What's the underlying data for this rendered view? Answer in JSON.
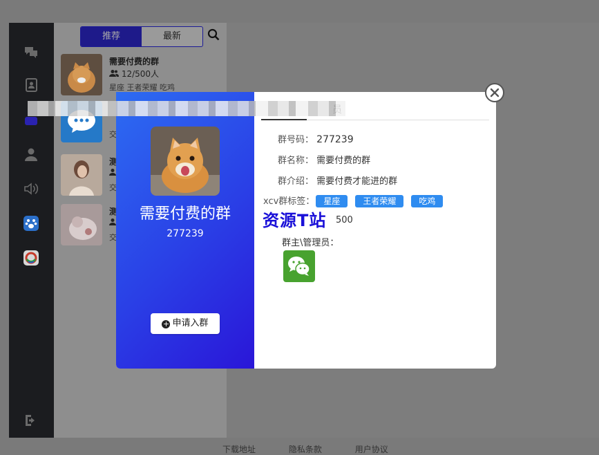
{
  "sidebar": {
    "icons": [
      "chat-icon",
      "contacts-icon",
      "group-icon",
      "user-icon",
      "speaker-icon",
      "paw-icon",
      "circle-app-icon",
      "logout-icon"
    ]
  },
  "list": {
    "tabs": [
      {
        "label": "推荐"
      },
      {
        "label": "最新"
      }
    ],
    "items": [
      {
        "title": "需要付费的群",
        "sub": "12/500人",
        "tags": "星座 王者荣耀 吃鸡"
      },
      {
        "title": "",
        "sub": "",
        "tags": "交"
      },
      {
        "title": "测",
        "sub": "",
        "tags": "交"
      },
      {
        "title": "测",
        "sub": "",
        "tags": "交"
      }
    ]
  },
  "bottom_links": [
    "下载地址",
    "隐私条款",
    "用户协议"
  ],
  "modal": {
    "name": "需要付费的群",
    "id": "277239",
    "join_label": "申请入群",
    "tab_label": "员",
    "fields": [
      {
        "label": "群号码：",
        "value": "277239"
      },
      {
        "label": "群名称：",
        "value": "需要付费的群"
      },
      {
        "label": "群介绍：",
        "value": "需要付费才能进的群"
      }
    ],
    "tags_label": "xcv群标签：",
    "tags": [
      "星座",
      "王者荣耀",
      "吃鸡"
    ],
    "count_partial": "500",
    "watermark": "资源T站",
    "admins_label": "群主\\管理员："
  },
  "colors": {
    "accent": "#2f8cf0",
    "modal_gradient_start": "#2d6cf2",
    "modal_gradient_end": "#2a16d8",
    "wechat": "#48a22f"
  }
}
